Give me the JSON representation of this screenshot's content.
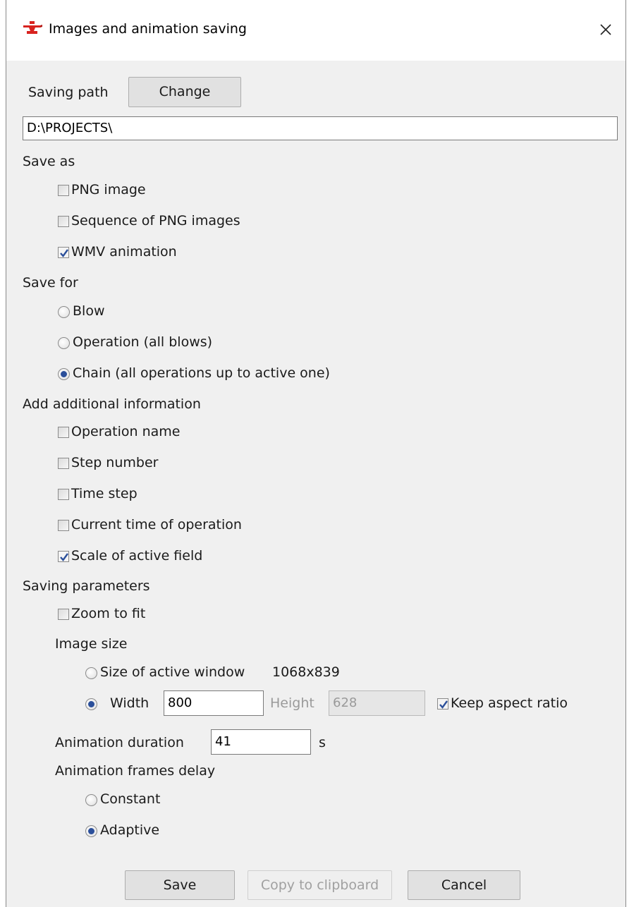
{
  "window": {
    "title": "Images and animation saving"
  },
  "saving_path": {
    "label": "Saving path",
    "change_button": "Change",
    "value": "D:\\PROJECTS\\"
  },
  "save_as": {
    "heading": "Save as",
    "png_image": "PNG image",
    "png_sequence": "Sequence of PNG images",
    "wmv_animation": "WMV animation"
  },
  "save_for": {
    "heading": "Save for",
    "blow": "Blow",
    "operation": "Operation (all blows)",
    "chain": "Chain (all operations up to active one)"
  },
  "additional_info": {
    "heading": "Add additional information",
    "operation_name": "Operation name",
    "step_number": "Step number",
    "time_step": "Time step",
    "current_time": "Current time of operation",
    "scale_active_field": "Scale of active field"
  },
  "saving_parameters": {
    "heading": "Saving parameters",
    "zoom_to_fit": "Zoom to fit",
    "image_size": {
      "heading": "Image size",
      "size_active_window": "Size of active window",
      "active_window_dims": "1068x839",
      "width_label": "Width",
      "width_value": "800",
      "height_label": "Height",
      "height_value": "628",
      "keep_aspect": "Keep aspect ratio"
    },
    "animation_duration": {
      "label": "Animation duration",
      "value": "41",
      "unit": "s"
    },
    "frames_delay": {
      "heading": "Animation frames delay",
      "constant": "Constant",
      "adaptive": "Adaptive"
    }
  },
  "footer": {
    "save": "Save",
    "copy": "Copy to clipboard",
    "cancel": "Cancel"
  },
  "colors": {
    "dialog_bg": "#f0f0f0",
    "accent": "#2b4f9a",
    "icon_red": "#d8231f"
  }
}
